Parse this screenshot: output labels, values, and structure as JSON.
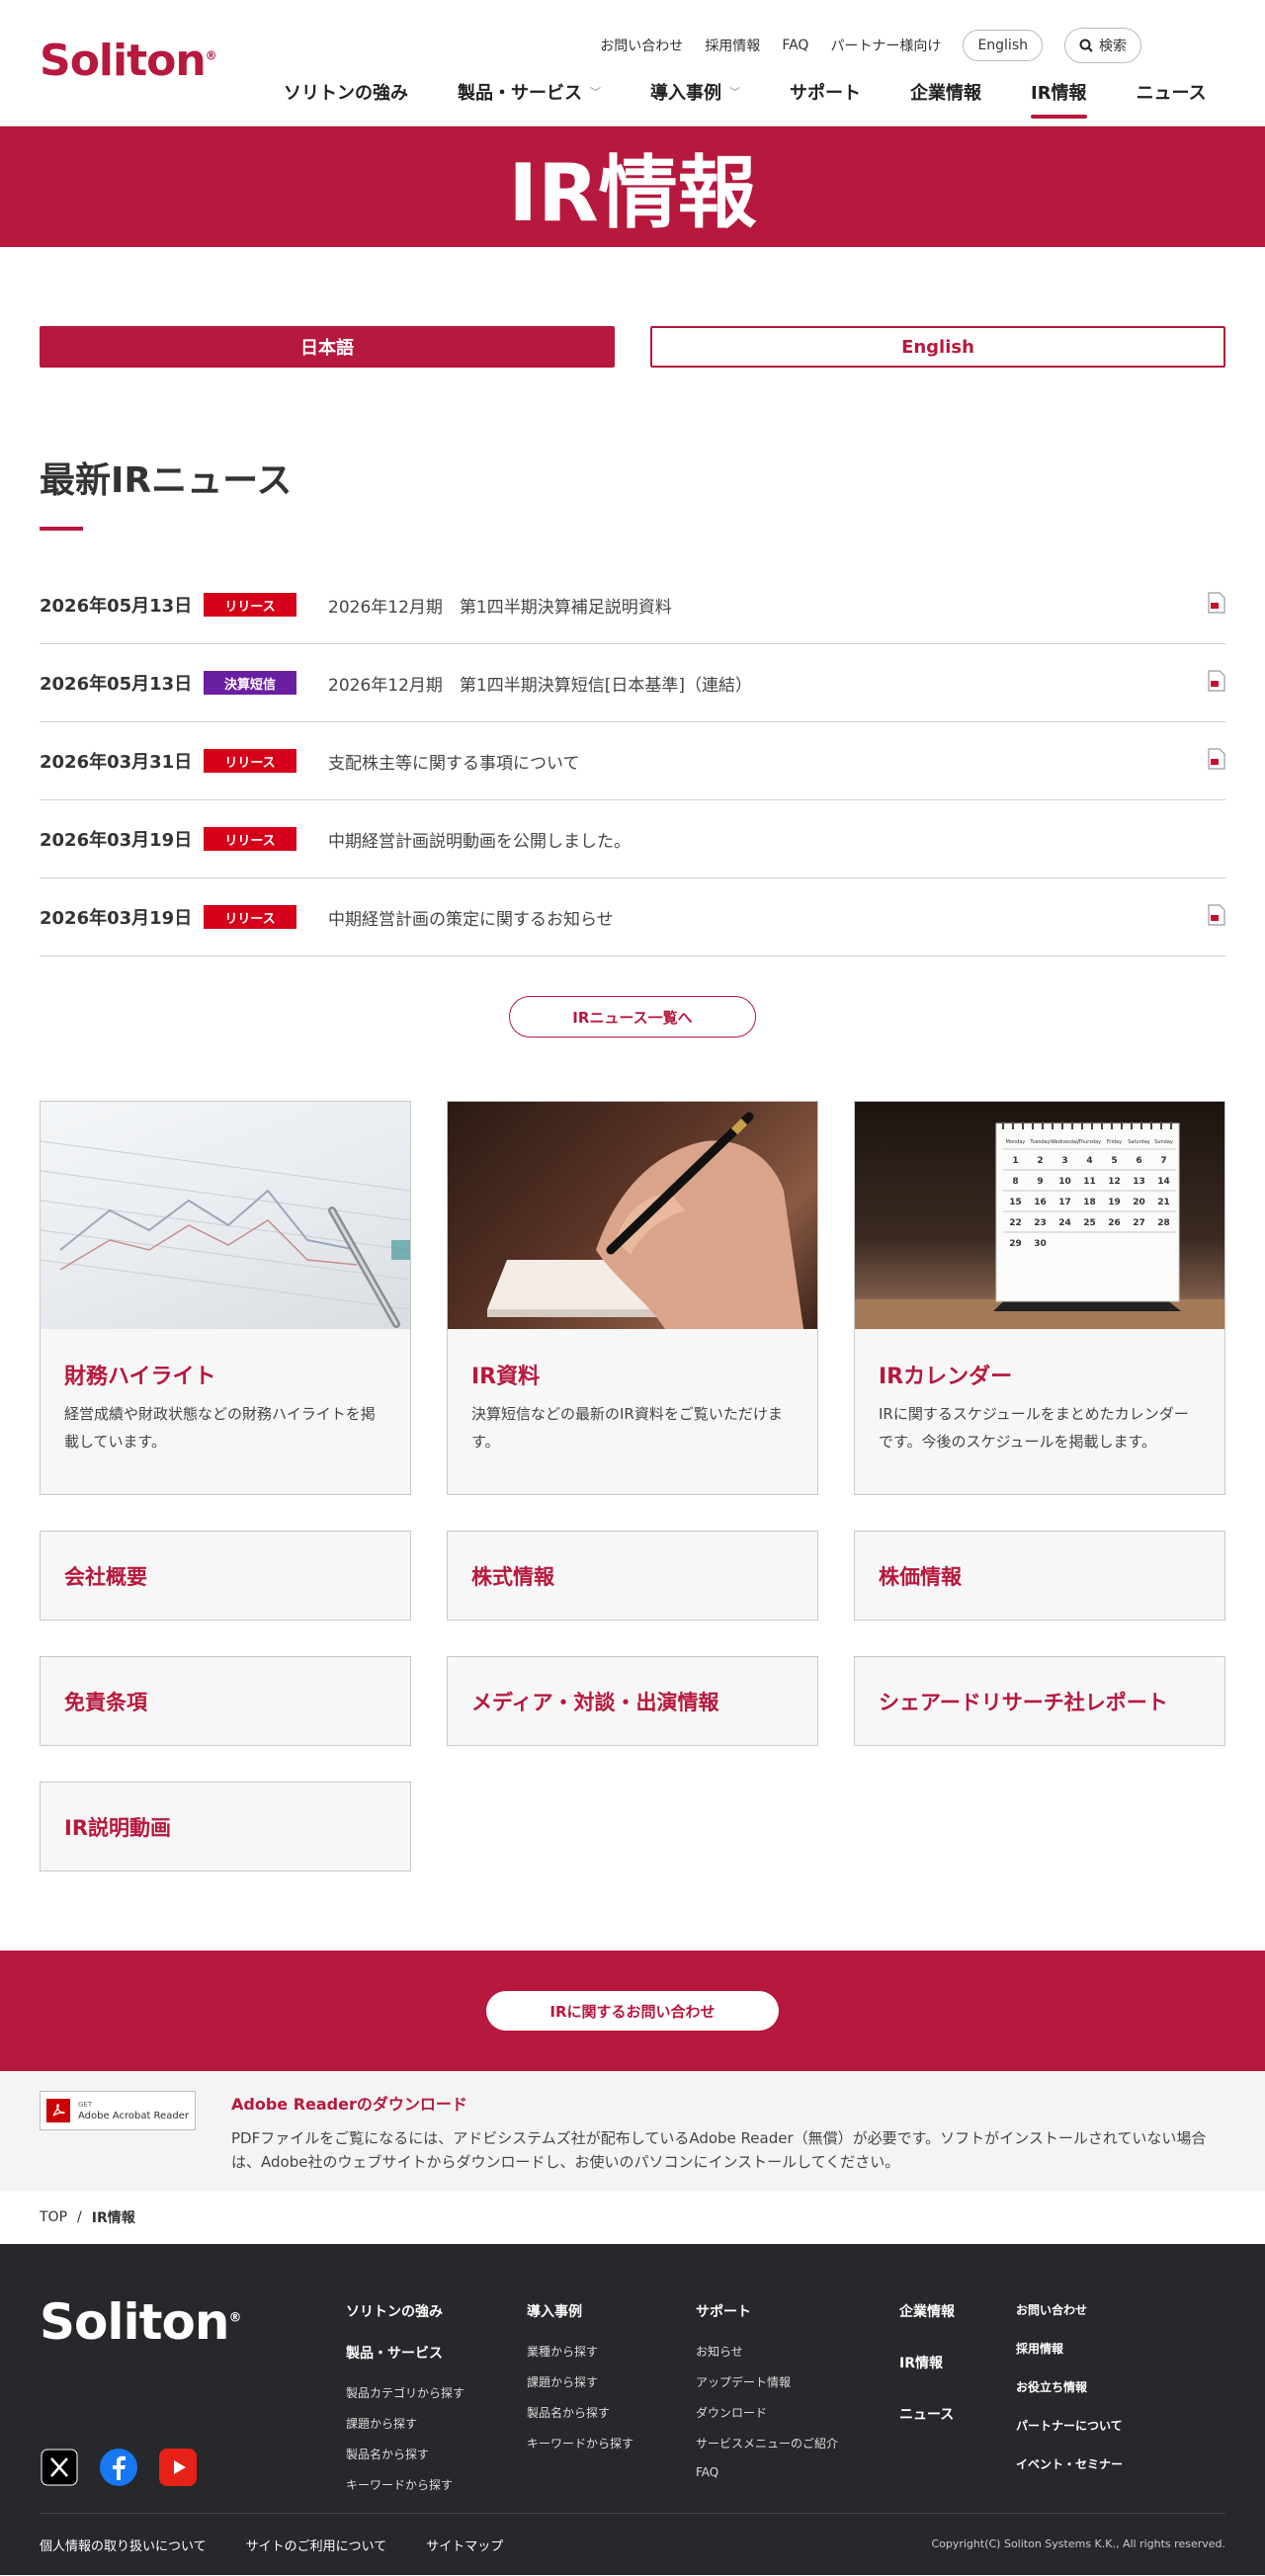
{
  "header": {
    "logo": "Soliton",
    "utility": [
      "お問い合わせ",
      "採用情報",
      "FAQ",
      "パートナー様向け"
    ],
    "english_btn": "English",
    "search_btn": "検索",
    "nav": [
      "ソリトンの強み",
      "製品・サービス",
      "導入事例",
      "サポート",
      "企業情報",
      "IR情報",
      "ニュース"
    ]
  },
  "hero": {
    "title": "IR情報"
  },
  "lang": {
    "ja": "日本語",
    "en": "English"
  },
  "news": {
    "heading": "最新IRニュース",
    "items": [
      {
        "date": "2026年05月13日",
        "tag": "リリース",
        "title": "2026年12月期　第1四半期決算補足説明資料"
      },
      {
        "date": "2026年05月13日",
        "tag": "決算短信",
        "title": "2026年12月期　第1四半期決算短信[日本基準]（連結）"
      },
      {
        "date": "2026年03月31日",
        "tag": "リリース",
        "title": "支配株主等に関する事項について"
      },
      {
        "date": "2026年03月19日",
        "tag": "リリース",
        "title": "中期経営計画説明動画を公開しました。"
      },
      {
        "date": "2026年03月19日",
        "tag": "リリース",
        "title": "中期経営計画の策定に関するお知らせ"
      }
    ],
    "more": "IRニュース一覧へ",
    "colors": {
      "release": "#d7001a",
      "tanshin": "#6a1fa2"
    }
  },
  "cards": [
    {
      "title": "財務ハイライト",
      "desc": "経営成績や財政状態などの財務ハイライトを掲載しています。"
    },
    {
      "title": "IR資料",
      "desc": "決算短信などの最新のIR資料をご覧いただけます。"
    },
    {
      "title": "IRカレンダー",
      "desc": "IRに関するスケジュールをまとめたカレンダーです。今後のスケジュールを掲載します。"
    }
  ],
  "tiles": [
    "会社概要",
    "株式情報",
    "株価情報",
    "免責条項",
    "メディア・対談・出演情報",
    "シェアードリサーチ社レポート",
    "IR説明動画"
  ],
  "calendar": {
    "days": [
      "Monday",
      "Tuesday",
      "Wednesday",
      "Thursday",
      "Friday",
      "Saturday",
      "Sunday"
    ],
    "rows": [
      [
        "1",
        "2",
        "3",
        "4",
        "5",
        "6",
        "7"
      ],
      [
        "8",
        "9",
        "10",
        "11",
        "12",
        "13",
        "14"
      ],
      [
        "15",
        "16",
        "17",
        "18",
        "19",
        "20",
        "21"
      ],
      [
        "22",
        "23",
        "24",
        "25",
        "26",
        "27",
        "28"
      ],
      [
        "29",
        "30",
        "",
        "",
        "",
        "",
        ""
      ]
    ]
  },
  "contact": {
    "label": "IRに関するお問い合わせ"
  },
  "adobe": {
    "badge_get": "GET",
    "badge_label": "Adobe Acrobat Reader",
    "title": "Adobe Readerのダウンロード",
    "desc": "PDFファイルをご覧になるには、アドビシステムズ社が配布しているAdobe Reader（無償）が必要です。ソフトがインストールされていない場合は、Adobe社のウェブサイトからダウンロードし、お使いのパソコンにインストールしてください。"
  },
  "breadcrumb": {
    "top": "TOP",
    "sep": "/",
    "current": "IR情報"
  },
  "footer": {
    "logo": "Soliton",
    "col1": {
      "h1": "ソリトンの強み",
      "h2": "製品・サービス",
      "items": [
        "製品カテゴリから探す",
        "課題から探す",
        "製品名から探す",
        "キーワードから探す"
      ]
    },
    "col2": {
      "h": "導入事例",
      "items": [
        "業種から探す",
        "課題から探す",
        "製品名から探す",
        "キーワードから探す"
      ]
    },
    "col3": {
      "h": "サポート",
      "items": [
        "お知らせ",
        "アップデート情報",
        "ダウンロード",
        "サービスメニューのご紹介",
        "FAQ"
      ]
    },
    "col4": [
      "企業情報",
      "IR情報",
      "ニュース"
    ],
    "col5": [
      "お問い合わせ",
      "採用情報",
      "お役立ち情報",
      "パートナーについて",
      "イベント・セミナー"
    ],
    "bottom_links": [
      "個人情報の取り扱いについて",
      "サイトのご利用について",
      "サイトマップ"
    ],
    "copyright": "Copyright(C) Soliton Systems K.K., All rights reserved."
  }
}
